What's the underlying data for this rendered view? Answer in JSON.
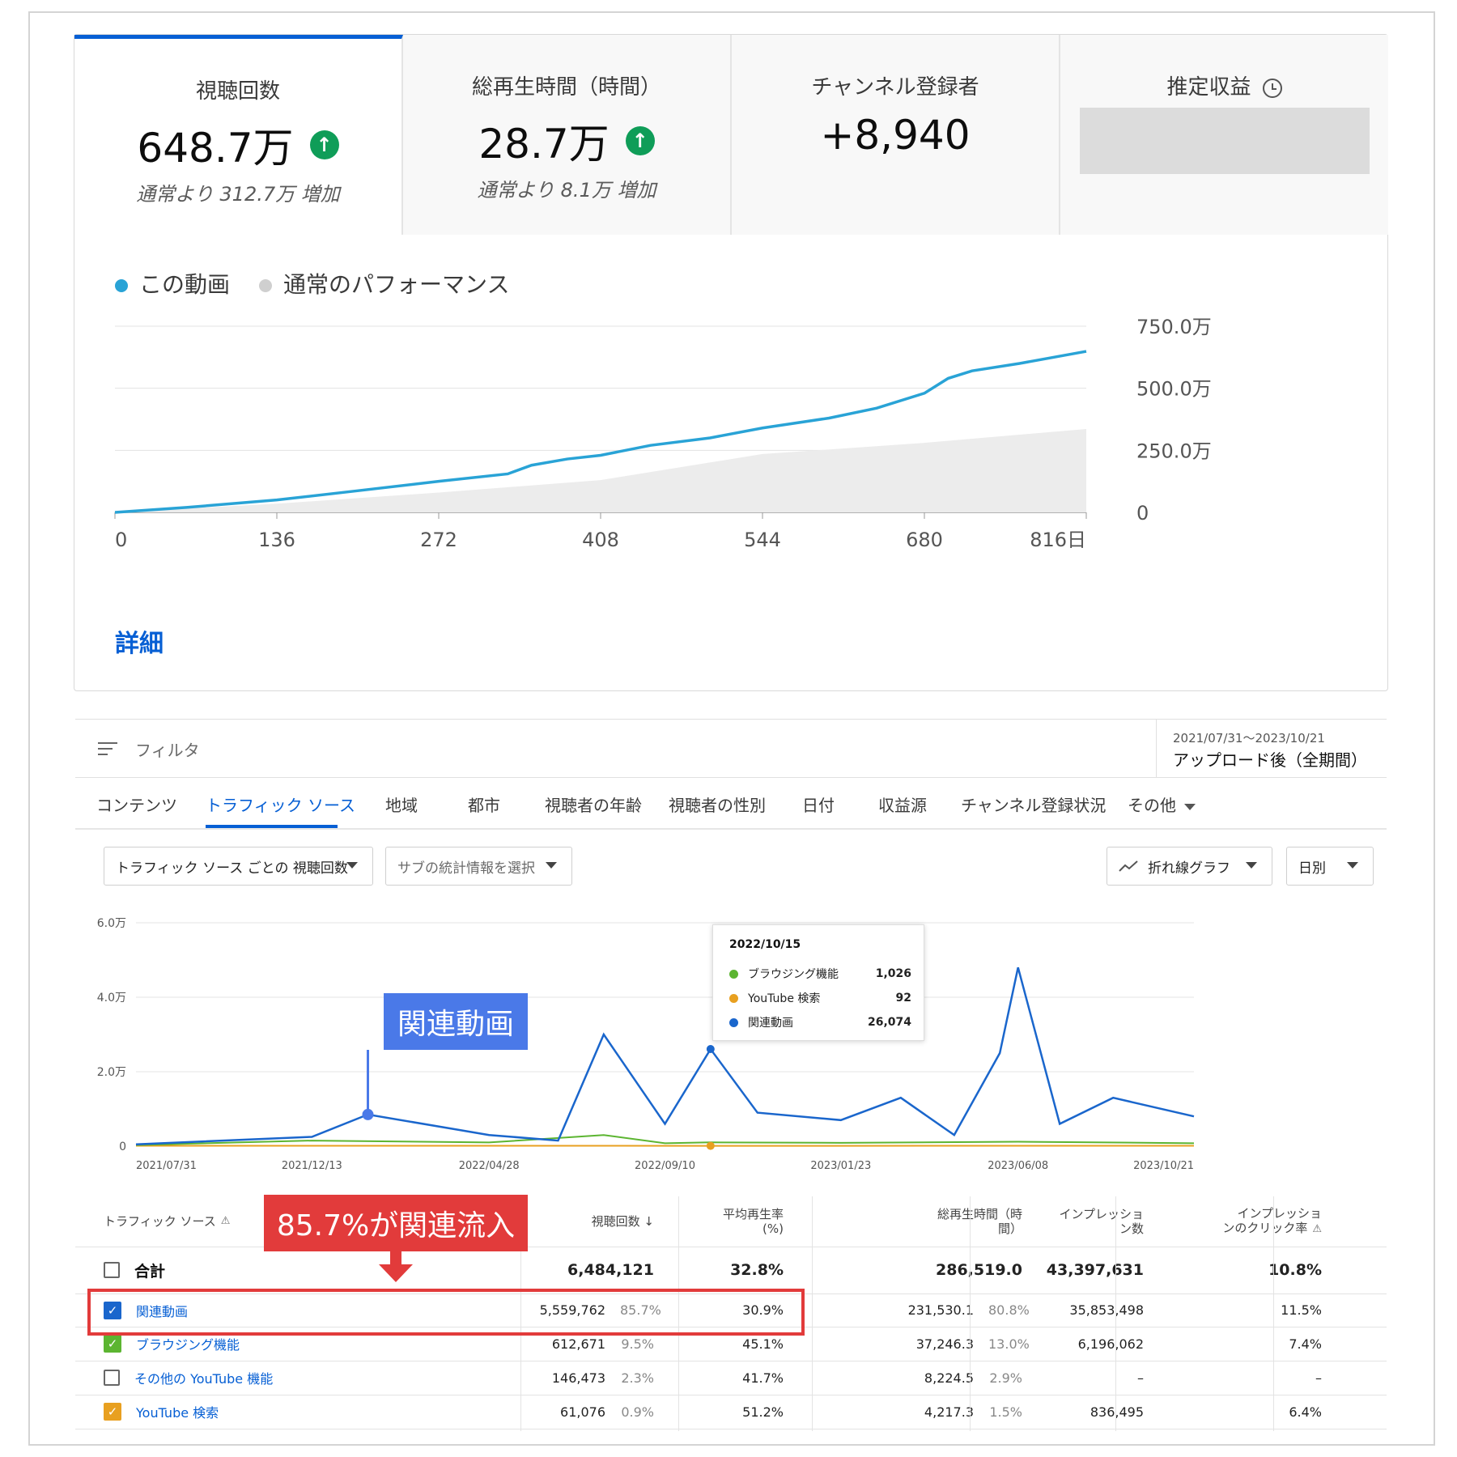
{
  "overview": {
    "metrics": [
      {
        "title": "視聴回数",
        "value": "648.7万",
        "sub": "通常より 312.7万 増加",
        "up": true
      },
      {
        "title": "総再生時間（時間）",
        "value": "28.7万",
        "sub": "通常より 8.1万 増加",
        "up": true
      },
      {
        "title": "チャンネル登録者",
        "value": "+8,940",
        "sub": ""
      },
      {
        "title": "推定収益",
        "value": "",
        "sub": ""
      }
    ],
    "legend": {
      "this_video": "この動画",
      "typical": "通常のパフォーマンス"
    },
    "detail_link": "詳細",
    "colors": {
      "this_video": "#29a3d6",
      "typical": "#cfcfcf",
      "accent": "#065fd4"
    }
  },
  "chart_data": [
    {
      "type": "line",
      "title": "",
      "x_unit": "日",
      "x_ticks": [
        "0",
        "136",
        "272",
        "408",
        "544",
        "680",
        "816日"
      ],
      "y_ticks": [
        "0",
        "250.0万",
        "500.0万",
        "750.0万"
      ],
      "xlim": [
        0,
        816
      ],
      "ylim": [
        0,
        7500000
      ],
      "series": [
        {
          "name": "この動画",
          "x": [
            0,
            60,
            136,
            200,
            272,
            330,
            350,
            380,
            408,
            450,
            500,
            544,
            600,
            640,
            680,
            700,
            720,
            760,
            816
          ],
          "y": [
            0,
            200000,
            500000,
            850000,
            1250000,
            1550000,
            1900000,
            2150000,
            2300000,
            2700000,
            3000000,
            3400000,
            3800000,
            4200000,
            4800000,
            5400000,
            5700000,
            6000000,
            6487000
          ]
        },
        {
          "name": "通常のパフォーマンス",
          "x": [
            0,
            136,
            272,
            408,
            544,
            680,
            816
          ],
          "y": [
            0,
            350000,
            800000,
            1300000,
            2350000,
            2800000,
            3360000
          ]
        }
      ]
    },
    {
      "type": "line",
      "title": "",
      "x_ticks": [
        "2021/07/31",
        "2021/12/13",
        "2022/04/28",
        "2022/09/10",
        "2023/01/23",
        "2023/06/08",
        "2023/10/21"
      ],
      "y_ticks": [
        "0",
        "2.0万",
        "4.0万",
        "6.0万"
      ],
      "ylim": [
        0,
        60000
      ],
      "series": [
        {
          "name": "関連動画",
          "x": [
            "2021/07/31",
            "2021/12/13",
            "2022/01/25",
            "2022/04/28",
            "2022/06/20",
            "2022/07/25",
            "2022/09/10",
            "2022/10/15",
            "2022/11/20",
            "2023/01/23",
            "2023/03/10",
            "2023/04/20",
            "2023/05/25",
            "2023/06/08",
            "2023/07/10",
            "2023/08/20",
            "2023/10/21"
          ],
          "y": [
            500,
            2500,
            8500,
            3000,
            1500,
            30000,
            6000,
            26074,
            9000,
            7000,
            13000,
            3000,
            25000,
            48000,
            6000,
            13000,
            8000
          ]
        },
        {
          "name": "ブラウジング機能",
          "x": [
            "2021/07/31",
            "2021/12/13",
            "2022/04/28",
            "2022/07/25",
            "2022/09/10",
            "2022/10/15",
            "2023/01/23",
            "2023/06/08",
            "2023/10/21"
          ],
          "y": [
            300,
            1500,
            1000,
            3000,
            800,
            1026,
            900,
            1200,
            800
          ]
        },
        {
          "name": "YouTube 検索",
          "x": [
            "2021/07/31",
            "2022/04/28",
            "2022/10/15",
            "2023/06/08",
            "2023/10/21"
          ],
          "y": [
            100,
            100,
            92,
            100,
            100
          ]
        }
      ]
    }
  ],
  "filter": {
    "label": "フィルタ",
    "range_small": "2021/07/31〜2023/10/21",
    "range_main": "アップロード後（全期間）"
  },
  "tabs": [
    "コンテンツ",
    "トラフィック ソース",
    "地域",
    "都市",
    "視聴者の年齢",
    "視聴者の性別",
    "日付",
    "収益源",
    "チャンネル登録状況",
    "その他"
  ],
  "controls": {
    "metric_select": "トラフィック ソース ごとの 視聴回数",
    "sub_metric": "サブの統計情報を選択",
    "chart_type": "折れ線グラフ",
    "granularity": "日別"
  },
  "tooltip": {
    "date": "2022/10/15",
    "rows": [
      {
        "name": "ブラウジング機能",
        "value": "1,026",
        "color": "#5cb531"
      },
      {
        "name": "YouTube 検索",
        "value": "92",
        "color": "#e8a020"
      },
      {
        "name": "関連動画",
        "value": "26,074",
        "color": "#1a66cc"
      }
    ]
  },
  "annotations": {
    "related_callout": "関連動画",
    "pct_callout": "85.7%が関連流入"
  },
  "table": {
    "headers": {
      "source": "トラフィック ソース",
      "views": "視聴回数 ↓",
      "avg_pct_1": "平均再生率",
      "avg_pct_2": "(%)",
      "watch_1": "総再生時間（時",
      "watch_2": "間）",
      "impr_1": "インプレッショ",
      "impr_2": "ン数",
      "ctr_1": "インプレッショ",
      "ctr_2": "ンのクリック率"
    },
    "total": {
      "label": "合計",
      "views": "6,484,121",
      "avg": "32.8%",
      "watch": "286,519.0",
      "impr": "43,397,631",
      "ctr": "10.8%"
    },
    "rows": [
      {
        "name": "関連動画",
        "views": "5,559,762",
        "views_pct": "85.7%",
        "avg": "30.9%",
        "watch": "231,530.1",
        "watch_pct": "80.8%",
        "impr": "35,853,498",
        "ctr": "11.5%",
        "checked": true,
        "color": "#1a66cc"
      },
      {
        "name": "ブラウジング機能",
        "views": "612,671",
        "views_pct": "9.5%",
        "avg": "45.1%",
        "watch": "37,246.3",
        "watch_pct": "13.0%",
        "impr": "6,196,062",
        "ctr": "7.4%",
        "checked": true,
        "color": "#5cb531"
      },
      {
        "name": "その他の YouTube 機能",
        "views": "146,473",
        "views_pct": "2.3%",
        "avg": "41.7%",
        "watch": "8,224.5",
        "watch_pct": "2.9%",
        "impr": "–",
        "ctr": "–",
        "checked": false,
        "color": ""
      },
      {
        "name": "YouTube 検索",
        "views": "61,076",
        "views_pct": "0.9%",
        "avg": "51.2%",
        "watch": "4,217.3",
        "watch_pct": "1.5%",
        "impr": "836,495",
        "ctr": "6.4%",
        "checked": true,
        "color": "#e8a020"
      }
    ]
  }
}
